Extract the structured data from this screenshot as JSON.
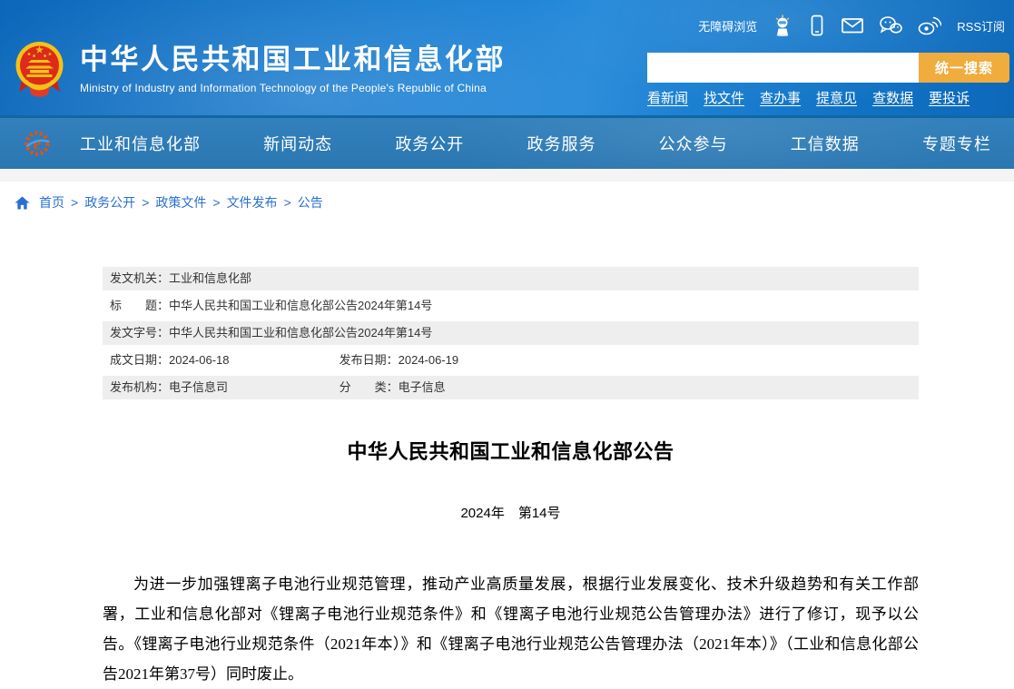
{
  "header": {
    "site_title": "中华人民共和国工业和信息化部",
    "site_subtitle": "Ministry of Industry and Information Technology of the People's Republic of China",
    "utility": {
      "accessibility_label": "无障碍浏览",
      "rss_label": "RSS订阅",
      "icons": [
        "robot-mascot-icon",
        "mobile-phone-icon",
        "mail-icon",
        "wechat-icon",
        "weibo-icon"
      ]
    },
    "search": {
      "placeholder": "",
      "value": "",
      "button_label": "统一搜索"
    },
    "quick_links": [
      "看新闻",
      "找文件",
      "查办事",
      "提意见",
      "查数据",
      "要投诉"
    ]
  },
  "nav": {
    "items": [
      "工业和信息化部",
      "新闻动态",
      "政务公开",
      "政务服务",
      "公众参与",
      "工信数据",
      "专题专栏"
    ]
  },
  "breadcrumb": {
    "separator": ">",
    "items": [
      "首页",
      "政务公开",
      "政策文件",
      "文件发布",
      "公告"
    ]
  },
  "meta": {
    "rows": [
      {
        "label": "发文机关：",
        "value": "工业和信息化部"
      },
      {
        "label": "标　　题：",
        "value": "中华人民共和国工业和信息化部公告2024年第14号"
      },
      {
        "label": "发文字号：",
        "value": "中华人民共和国工业和信息化部公告2024年第14号"
      },
      {
        "label": "成文日期：",
        "value": "2024-06-18",
        "label2": "发布日期：",
        "value2": "2024-06-19"
      },
      {
        "label": "发布机构：",
        "value": "电子信息司",
        "label2": "分　　类：",
        "value2": "电子信息"
      }
    ]
  },
  "article": {
    "title": "中华人民共和国工业和信息化部公告",
    "issue_line": "2024年　第14号",
    "body": "为进一步加强锂离子电池行业规范管理，推动产业高质量发展，根据行业发展变化、技术升级趋势和有关工作部署，工业和信息化部对《锂离子电池行业规范条件》和《锂离子电池行业规范公告管理办法》进行了修订，现予以公告。《锂离子电池行业规范条件（2021年本）》和《锂离子电池行业规范公告管理办法（2021年本）》（工业和信息化部公告2021年第37号）同时废止。"
  },
  "colors": {
    "header_blue": "#1b7fd2",
    "nav_blue": "#2e7cb7",
    "accent_orange": "#f0ac3d",
    "breadcrumb_blue": "#2a6fd0",
    "meta_row_gray": "#eeeeee",
    "emblem_red": "#dd2a1b",
    "emblem_gold": "#f3c216"
  }
}
